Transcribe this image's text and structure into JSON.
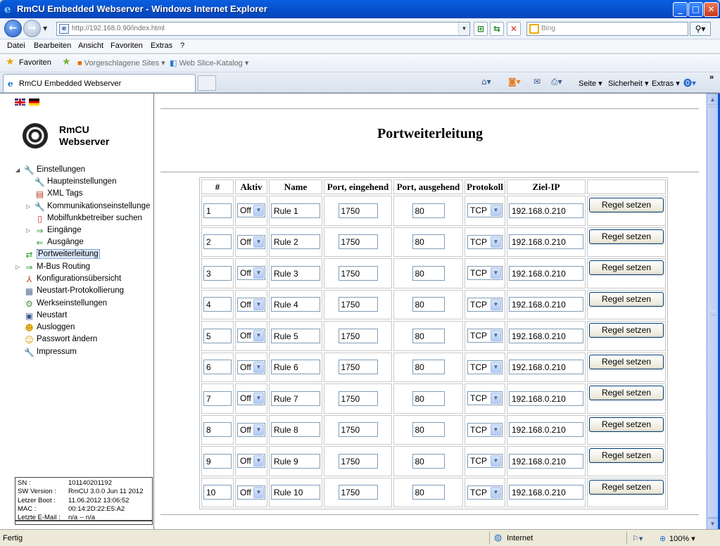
{
  "window": {
    "title": "RmCU Embedded Webserver - Windows Internet Explorer",
    "minimize": "_",
    "maximize": "□",
    "close": "✕"
  },
  "address": {
    "url": "http://192.168.0.90/index.html",
    "search_placeholder": "Bing"
  },
  "menu": [
    "Datei",
    "Bearbeiten",
    "Ansicht",
    "Favoriten",
    "Extras",
    "?"
  ],
  "favorites_bar": {
    "favorites": "Favoriten",
    "suggested": "Vorgeschlagene Sites ▾",
    "webslice": "Web Slice-Katalog ▾"
  },
  "tabs": {
    "active": "RmCU Embedded Webserver"
  },
  "command_bar": {
    "page": "Seite ▾",
    "safety": "Sicherheit ▾",
    "tools": "Extras ▾"
  },
  "sidebar": {
    "logo_line1": "RmCU",
    "logo_line2": "Webserver",
    "items": {
      "einstellungen": "Einstellungen",
      "haupteinstellungen": "Haupteinstellungen",
      "xml_tags": "XML Tags",
      "kommunikation": "Kommunikationseinstellunge",
      "mobilfunk": "Mobilfunkbetreiber suchen",
      "eingaenge": "Eingänge",
      "ausgaenge": "Ausgänge",
      "portweiterleitung": "Portweiterleitung",
      "mbus": "M-Bus Routing",
      "konfig": "Konfigurationsübersicht",
      "neustart_prot": "Neustart-Protokollierung",
      "werks": "Werkseinstellungen",
      "neustart": "Neustart",
      "ausloggen": "Ausloggen",
      "passwort": "Passwort ändern",
      "impressum": "Impressum"
    },
    "info": {
      "sn_label": "SN :",
      "sn": "101140201192",
      "sw_label": "SW Version :",
      "sw": "RmCU 3.0.0 Jun 11 2012",
      "boot_label": "Letzer Boot :",
      "boot": "11.06.2012 13:06:52",
      "mac_label": "MAC :",
      "mac": "00:14:2D:22:E5:A2",
      "email_label": "Letzte E-Mail :",
      "email": "n/a -- n/a"
    }
  },
  "page_title": "Portweiterleitung",
  "table": {
    "headers": [
      "#",
      "Aktiv",
      "Name",
      "Port, eingehend",
      "Port, ausgehend",
      "Protokoll",
      "Ziel-IP",
      ""
    ],
    "button_label": "Regel setzen",
    "rows": [
      {
        "num": "1",
        "aktiv": "Off",
        "name": "Rule 1",
        "in": "1750",
        "out": "80",
        "proto": "TCP",
        "ip": "192.168.0.210"
      },
      {
        "num": "2",
        "aktiv": "Off",
        "name": "Rule 2",
        "in": "1750",
        "out": "80",
        "proto": "TCP",
        "ip": "192.168.0.210"
      },
      {
        "num": "3",
        "aktiv": "Off",
        "name": "Rule 3",
        "in": "1750",
        "out": "80",
        "proto": "TCP",
        "ip": "192.168.0.210"
      },
      {
        "num": "4",
        "aktiv": "Off",
        "name": "Rule 4",
        "in": "1750",
        "out": "80",
        "proto": "TCP",
        "ip": "192.168.0.210"
      },
      {
        "num": "5",
        "aktiv": "Off",
        "name": "Rule 5",
        "in": "1750",
        "out": "80",
        "proto": "TCP",
        "ip": "192.168.0.210"
      },
      {
        "num": "6",
        "aktiv": "Off",
        "name": "Rule 6",
        "in": "1750",
        "out": "80",
        "proto": "TCP",
        "ip": "192.168.0.210"
      },
      {
        "num": "7",
        "aktiv": "Off",
        "name": "Rule 7",
        "in": "1750",
        "out": "80",
        "proto": "TCP",
        "ip": "192.168.0.210"
      },
      {
        "num": "8",
        "aktiv": "Off",
        "name": "Rule 8",
        "in": "1750",
        "out": "80",
        "proto": "TCP",
        "ip": "192.168.0.210"
      },
      {
        "num": "9",
        "aktiv": "Off",
        "name": "Rule 9",
        "in": "1750",
        "out": "80",
        "proto": "TCP",
        "ip": "192.168.0.210"
      },
      {
        "num": "10",
        "aktiv": "Off",
        "name": "Rule 10",
        "in": "1750",
        "out": "80",
        "proto": "TCP",
        "ip": "192.168.0.210"
      }
    ]
  },
  "status": {
    "left": "Fertig",
    "zone": "Internet",
    "zoom": "100% ▾"
  },
  "icons": {
    "ie": "ie-logo-icon",
    "back": "back-arrow-icon",
    "forward": "forward-arrow-icon",
    "search": "magnifier-icon",
    "home": "home-icon",
    "rss": "rss-feed-icon",
    "mail": "mail-icon",
    "print": "printer-icon",
    "help": "help-icon",
    "globe": "globe-icon"
  },
  "colors": {
    "title_bar": "#0751cf",
    "selection_bg": "#dbe8fa"
  }
}
